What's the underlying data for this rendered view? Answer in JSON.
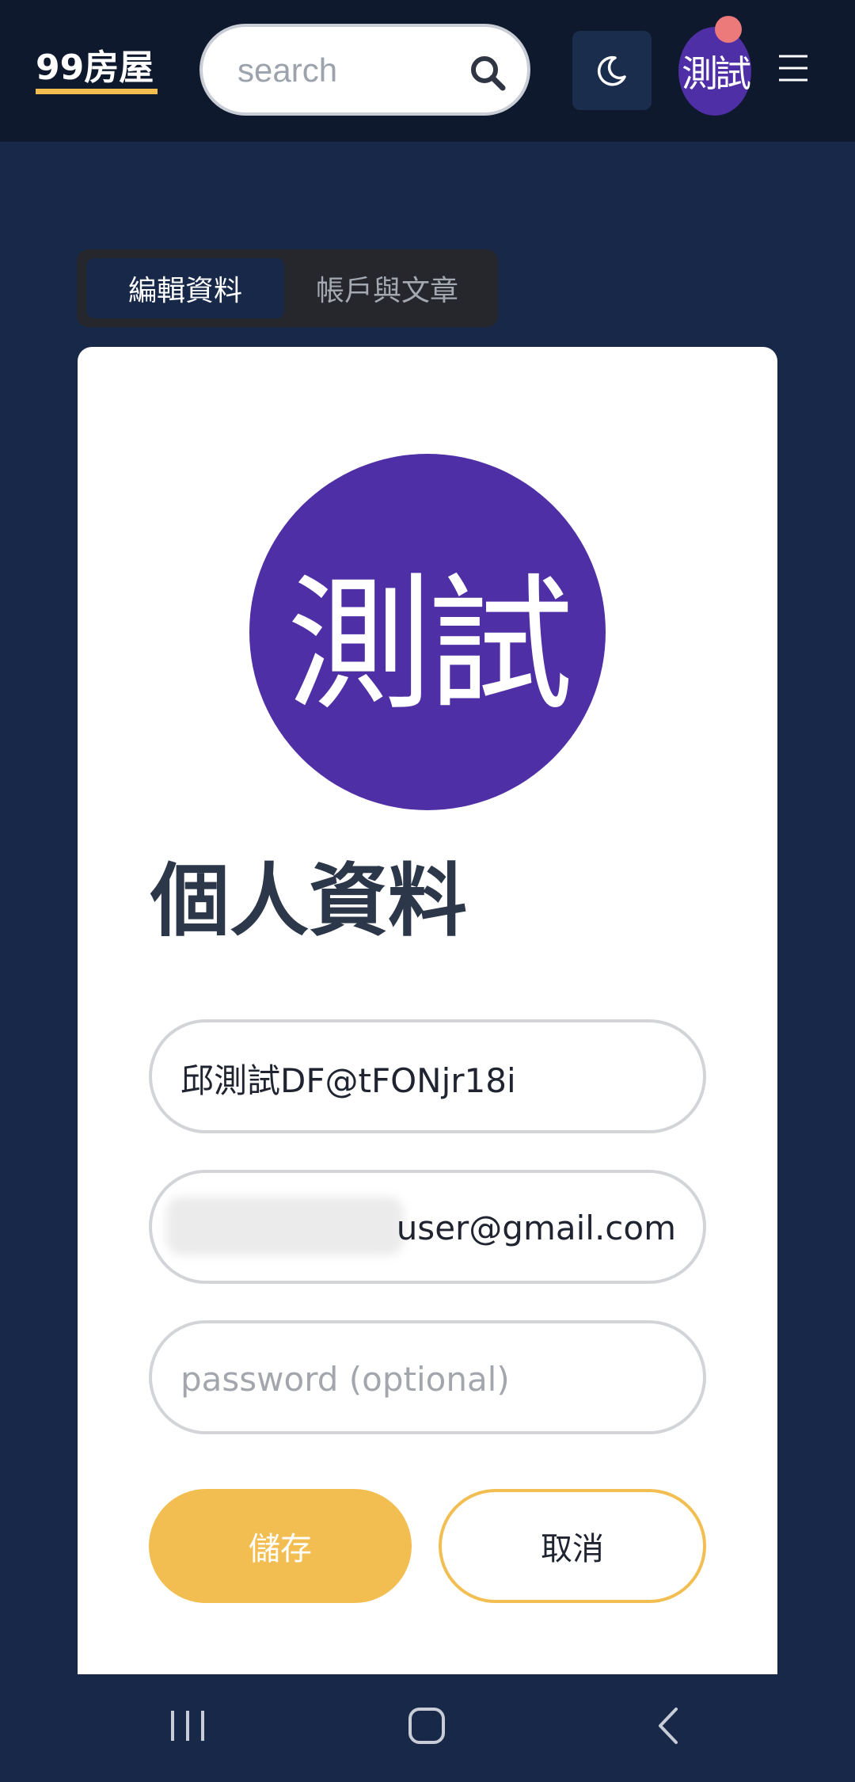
{
  "header": {
    "logo": "99房屋",
    "search_placeholder": "search",
    "avatar_text": "測試"
  },
  "tabs": [
    {
      "label": "編輯資料",
      "active": true
    },
    {
      "label": "帳戶與文章",
      "active": false
    }
  ],
  "profile": {
    "avatar_text": "測試",
    "title": "個人資料",
    "name_value": "邱測試DF@tFONjr18i",
    "email_visible": "user@gmail.com",
    "password_placeholder": "password (optional)",
    "save_label": "儲存",
    "cancel_label": "取消"
  },
  "colors": {
    "page_bg": "#172849",
    "header_bg": "#0f192d",
    "accent_yellow": "#f2be51",
    "avatar_purple": "#4f2fa5",
    "badge_red": "#ec7a7a"
  },
  "icons": {
    "search": "search-icon",
    "theme": "moon-icon",
    "menu": "hamburger-menu-icon",
    "nav_recent": "recent-apps-icon",
    "nav_home": "home-icon",
    "nav_back": "back-icon"
  }
}
